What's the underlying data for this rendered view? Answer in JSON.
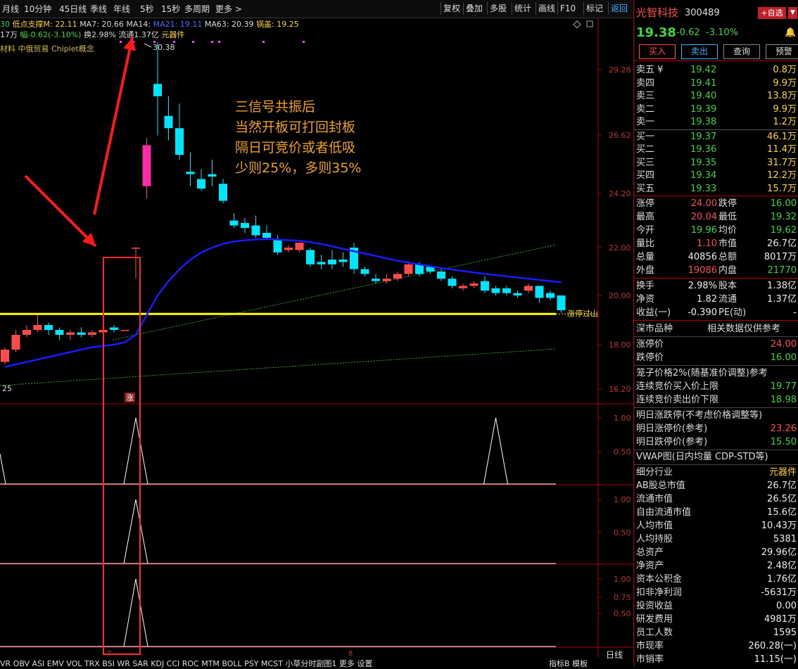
{
  "toolbar": {
    "left_items": [
      "月线",
      "10分钟",
      "45日线",
      "季线",
      "年线",
      "5秒",
      "15秒",
      "多周期",
      "更多 >"
    ],
    "right_items": [
      "复权",
      "叠加",
      "多股",
      "统计",
      "画线",
      "F10",
      "标记",
      "返回"
    ]
  },
  "ma_line": {
    "prefix": "30",
    "low_support": "低点支撑M: 22.11",
    "ma7": "MA7: 20.66",
    "ma14": "MA14: ",
    "ma21": "MA21: 19.11",
    "ma63": "MA63: 20.39",
    "guogai": "锅盖: 19.25"
  },
  "stat_line": {
    "vol": "17万",
    "amp": "幅-0.62(-3.10%)",
    "turnover": "换2.98%",
    "float": "流通1.37亿",
    "industry": "元器件"
  },
  "concept_line": "材料 中俄贸易 Chiplet概念",
  "chart": {
    "price_labels": [
      "29.28",
      "26.62",
      "24.20",
      "22.00",
      "20.00",
      "18.00",
      "16.20"
    ],
    "high_label": "30.38",
    "left_low_label": "25",
    "limit_label": "涨停过山",
    "limit_flag": "涨",
    "ind1_labels": [
      "1.00",
      "0.50"
    ],
    "ind2_labels": [
      "1.00",
      "0.50"
    ],
    "ind3_labels": [
      "1.00",
      "0.75",
      "0.50"
    ],
    "bottom_marker": "8",
    "bottom_marker_left": "7",
    "annotation": [
      "三信号共振后",
      "当然开板可打回封板",
      "隔日可竞价或者低吸",
      "少则25%，多则35%"
    ]
  },
  "bottom_bar": "VR OBV ASI EMV VOL TRX BSI WR SAR KDJ CCI ROC MTM BOLL PSY MCST 小草分时副图1 更多 设置",
  "bottom_right": [
    "日线",
    "指标B",
    "模板"
  ],
  "stock": {
    "name": "光智科技",
    "code": "300489",
    "add_btn": "+自选",
    "price": "19.38",
    "change": "-0.62",
    "pct": "-3.10%",
    "buttons": [
      "买入",
      "卖出",
      "查询",
      "预警"
    ]
  },
  "asks": [
    {
      "label": "卖五 ¥",
      "price": "19.42",
      "vol": "0.8万"
    },
    {
      "label": "卖四",
      "price": "19.41",
      "vol": "9.9万"
    },
    {
      "label": "卖三",
      "price": "19.40",
      "vol": "13.8万"
    },
    {
      "label": "卖二",
      "price": "19.39",
      "vol": "9.9万"
    },
    {
      "label": "卖一",
      "price": "19.38",
      "vol": "1.2万"
    }
  ],
  "bids": [
    {
      "label": "买一",
      "price": "19.37",
      "vol": "46.1万"
    },
    {
      "label": "买二",
      "price": "19.36",
      "vol": "11.4万"
    },
    {
      "label": "买三",
      "price": "19.35",
      "vol": "31.7万"
    },
    {
      "label": "买四",
      "price": "19.34",
      "vol": "12.2万"
    },
    {
      "label": "买五",
      "price": "19.33",
      "vol": "15.7万"
    }
  ],
  "quote_rows": [
    {
      "l1": "涨停",
      "v1": "24.00",
      "l2": "跌停",
      "v2": "16.00",
      "c1": "red",
      "c2": "grn"
    },
    {
      "l1": "最高",
      "v1": "20.04",
      "l2": "最低",
      "v2": "19.32",
      "c1": "red",
      "c2": "grn"
    },
    {
      "l1": "今开",
      "v1": "19.96",
      "l2": "均价",
      "v2": "19.62",
      "c1": "grn",
      "c2": "grn"
    },
    {
      "l1": "量比",
      "v1": "1.10",
      "l2": "市值",
      "v2": "26.7亿",
      "c1": "red",
      "c2": "wht"
    },
    {
      "l1": "总量",
      "v1": "40856",
      "l2": "总额",
      "v2": "8017万",
      "c1": "wht",
      "c2": "wht"
    },
    {
      "l1": "外盘",
      "v1": "19086",
      "l2": "内盘",
      "v2": "21770",
      "c1": "red",
      "c2": "grn"
    }
  ],
  "fin_rows": [
    {
      "l1": "换手",
      "v1": "2.98%",
      "l2": "股本",
      "v2": "1.38亿"
    },
    {
      "l1": "净资",
      "v1": "1.82",
      "l2": "流通",
      "v2": "1.37亿"
    },
    {
      "l1": "收益(一)",
      "v1": "-0.390",
      "l2": "PE(动)",
      "v2": "-"
    }
  ],
  "market": {
    "left": "深市品种",
    "right": "相关数据仅供参考"
  },
  "limit_rows": [
    {
      "label": "涨停价",
      "val": "24.00",
      "c": "red"
    },
    {
      "label": "跌停价",
      "val": "16.00",
      "c": "grn"
    }
  ],
  "cage": {
    "label": "笼子价格2%(随基准价调整)参考"
  },
  "auction_rows": [
    {
      "label": "连续竞价买入价上限",
      "val": "19.77",
      "c": "grn"
    },
    {
      "label": "连续竞价卖出价下限",
      "val": "18.98",
      "c": "grn"
    }
  ],
  "tomorrow": {
    "label": "明日涨跌停(不考虑价格调整等)"
  },
  "tomorrow_rows": [
    {
      "label": "明日涨停价(参考)",
      "val": "23.26",
      "c": "red"
    },
    {
      "label": "明日跌停价(参考)",
      "val": "15.50",
      "c": "grn"
    }
  ],
  "vwap": {
    "label": "VWAP图(日内均量 CDP-STD等)"
  },
  "detail_rows": [
    {
      "label": "细分行业",
      "val": "元器件",
      "c": "yel"
    },
    {
      "label": "AB股总市值",
      "val": "26.7亿",
      "c": "wht"
    },
    {
      "label": "流通市值",
      "val": "26.5亿",
      "c": "wht"
    },
    {
      "label": "自由流通市值",
      "val": "15.6亿",
      "c": "wht"
    },
    {
      "label": "人均市值",
      "val": "10.43万",
      "c": "wht"
    },
    {
      "label": "人均持股",
      "val": "5381",
      "c": "wht"
    },
    {
      "label": "总资产",
      "val": "29.96亿",
      "c": "wht"
    },
    {
      "label": "净资产",
      "val": "2.48亿",
      "c": "wht"
    },
    {
      "label": "资本公积金",
      "val": "1.76亿",
      "c": "wht"
    },
    {
      "label": "扣非净利润",
      "val": "-5631万",
      "c": "wht"
    },
    {
      "label": "投资收益",
      "val": "0.00",
      "c": "wht"
    },
    {
      "label": "研发费用",
      "val": "4981万",
      "c": "wht"
    },
    {
      "label": "员工人数",
      "val": "1595",
      "c": "wht"
    },
    {
      "label": "市现率",
      "val": "260.28(一)",
      "c": "wht"
    },
    {
      "label": "市销率",
      "val": "11.15(一)",
      "c": "wht"
    }
  ],
  "colors": {
    "up": "#ff4b4b",
    "down": "#00e5ff",
    "ma": "#1a1aff",
    "limit": "#ffff00",
    "box": "#ff2a2a",
    "arrow": "#ff1a1a"
  },
  "chart_data": {
    "type": "candlestick",
    "y_axis_ticks": [
      29.28,
      26.62,
      24.2,
      22.0,
      20.0,
      18.0,
      16.2
    ],
    "high_mark": 30.38,
    "limit_line": 19.25,
    "candles": [
      {
        "o": 17.3,
        "c": 17.8,
        "h": 17.9,
        "l": 17.2
      },
      {
        "o": 17.8,
        "c": 18.4,
        "h": 18.6,
        "l": 17.7
      },
      {
        "o": 18.4,
        "c": 18.6,
        "h": 18.8,
        "l": 18.3
      },
      {
        "o": 18.6,
        "c": 18.8,
        "h": 19.2,
        "l": 18.5
      },
      {
        "o": 18.8,
        "c": 18.6,
        "h": 18.9,
        "l": 18.4
      },
      {
        "o": 18.6,
        "c": 18.4,
        "h": 18.7,
        "l": 18.2
      },
      {
        "o": 18.4,
        "c": 18.5,
        "h": 18.6,
        "l": 18.2
      },
      {
        "o": 18.5,
        "c": 18.4,
        "h": 18.7,
        "l": 18.3
      },
      {
        "o": 18.4,
        "c": 18.5,
        "h": 18.6,
        "l": 18.3
      },
      {
        "o": 18.5,
        "c": 18.6,
        "h": 18.7,
        "l": 18.4
      },
      {
        "o": 18.7,
        "c": 18.6,
        "h": 18.8,
        "l": 18.5
      },
      {
        "o": 18.6,
        "c": 18.6,
        "h": 18.6,
        "l": 18.6
      },
      {
        "o": 22.0,
        "c": 22.0,
        "h": 22.0,
        "l": 20.7
      },
      {
        "o": 24.5,
        "c": 26.2,
        "h": 26.5,
        "l": 24.0
      },
      {
        "o": 28.7,
        "c": 28.2,
        "h": 30.4,
        "l": 26.6
      },
      {
        "o": 27.4,
        "c": 26.9,
        "h": 28.2,
        "l": 26.4
      },
      {
        "o": 26.9,
        "c": 25.8,
        "h": 27.9,
        "l": 25.6
      },
      {
        "o": 25.1,
        "c": 25.0,
        "h": 25.9,
        "l": 24.5
      },
      {
        "o": 24.8,
        "c": 24.4,
        "h": 25.2,
        "l": 24.3
      },
      {
        "o": 25.0,
        "c": 24.9,
        "h": 25.6,
        "l": 24.5
      },
      {
        "o": 24.6,
        "c": 23.9,
        "h": 24.8,
        "l": 23.8
      },
      {
        "o": 23.1,
        "c": 22.9,
        "h": 23.4,
        "l": 22.8
      },
      {
        "o": 23.0,
        "c": 22.8,
        "h": 23.2,
        "l": 22.6
      },
      {
        "o": 22.9,
        "c": 22.5,
        "h": 23.3,
        "l": 22.4
      },
      {
        "o": 22.6,
        "c": 22.4,
        "h": 22.9,
        "l": 22.3
      },
      {
        "o": 22.3,
        "c": 21.8,
        "h": 22.5,
        "l": 21.7
      },
      {
        "o": 21.9,
        "c": 22.0,
        "h": 22.1,
        "l": 21.8
      },
      {
        "o": 21.9,
        "c": 22.2,
        "h": 22.2,
        "l": 21.8
      },
      {
        "o": 21.9,
        "c": 21.3,
        "h": 22.0,
        "l": 21.2
      },
      {
        "o": 21.4,
        "c": 21.3,
        "h": 21.7,
        "l": 21.1
      },
      {
        "o": 21.5,
        "c": 21.3,
        "h": 21.9,
        "l": 21.1
      },
      {
        "o": 21.5,
        "c": 21.4,
        "h": 21.8,
        "l": 21.2
      },
      {
        "o": 22.0,
        "c": 21.1,
        "h": 22.2,
        "l": 20.9
      },
      {
        "o": 21.1,
        "c": 20.9,
        "h": 21.2,
        "l": 20.8
      },
      {
        "o": 20.7,
        "c": 20.6,
        "h": 20.9,
        "l": 20.5
      },
      {
        "o": 20.6,
        "c": 20.7,
        "h": 20.9,
        "l": 20.5
      },
      {
        "o": 20.7,
        "c": 20.9,
        "h": 21.0,
        "l": 20.6
      },
      {
        "o": 20.9,
        "c": 21.3,
        "h": 21.4,
        "l": 20.8
      },
      {
        "o": 21.3,
        "c": 20.9,
        "h": 21.4,
        "l": 20.8
      },
      {
        "o": 21.2,
        "c": 21.0,
        "h": 21.2,
        "l": 20.9
      },
      {
        "o": 21.0,
        "c": 20.7,
        "h": 21.1,
        "l": 20.6
      },
      {
        "o": 20.7,
        "c": 20.4,
        "h": 20.8,
        "l": 20.3
      },
      {
        "o": 20.3,
        "c": 20.4,
        "h": 20.5,
        "l": 20.2
      },
      {
        "o": 20.4,
        "c": 20.5,
        "h": 20.6,
        "l": 20.3
      },
      {
        "o": 20.6,
        "c": 20.2,
        "h": 20.8,
        "l": 20.1
      },
      {
        "o": 20.3,
        "c": 20.1,
        "h": 20.4,
        "l": 20.0
      },
      {
        "o": 20.3,
        "c": 20.1,
        "h": 20.4,
        "l": 20.0
      },
      {
        "o": 20.1,
        "c": 20.0,
        "h": 20.2,
        "l": 19.9
      },
      {
        "o": 20.2,
        "c": 20.4,
        "h": 20.5,
        "l": 20.1
      },
      {
        "o": 20.4,
        "c": 19.9,
        "h": 20.4,
        "l": 19.7
      },
      {
        "o": 20.1,
        "c": 19.9,
        "h": 20.2,
        "l": 19.8
      },
      {
        "o": 20.0,
        "c": 19.4,
        "h": 20.0,
        "l": 19.3
      }
    ],
    "ma21": [
      17.1,
      17.2,
      17.3,
      17.4,
      17.5,
      17.6,
      17.7,
      17.8,
      17.9,
      17.95,
      18.0,
      18.1,
      18.4,
      19.2,
      20.0,
      20.6,
      21.1,
      21.5,
      21.8,
      22.0,
      22.15,
      22.25,
      22.3,
      22.33,
      22.35,
      22.33,
      22.3,
      22.28,
      22.22,
      22.15,
      22.05,
      21.95,
      21.85,
      21.75,
      21.65,
      21.55,
      21.45,
      21.38,
      21.3,
      21.22,
      21.15,
      21.08,
      21.02,
      20.96,
      20.9,
      20.85,
      20.8,
      20.75,
      20.7,
      20.65,
      20.6,
      20.55
    ],
    "indicator_spikes": {
      "ind1": [
        12,
        45
      ],
      "ind2": [
        12
      ],
      "ind3": [
        12
      ]
    }
  }
}
